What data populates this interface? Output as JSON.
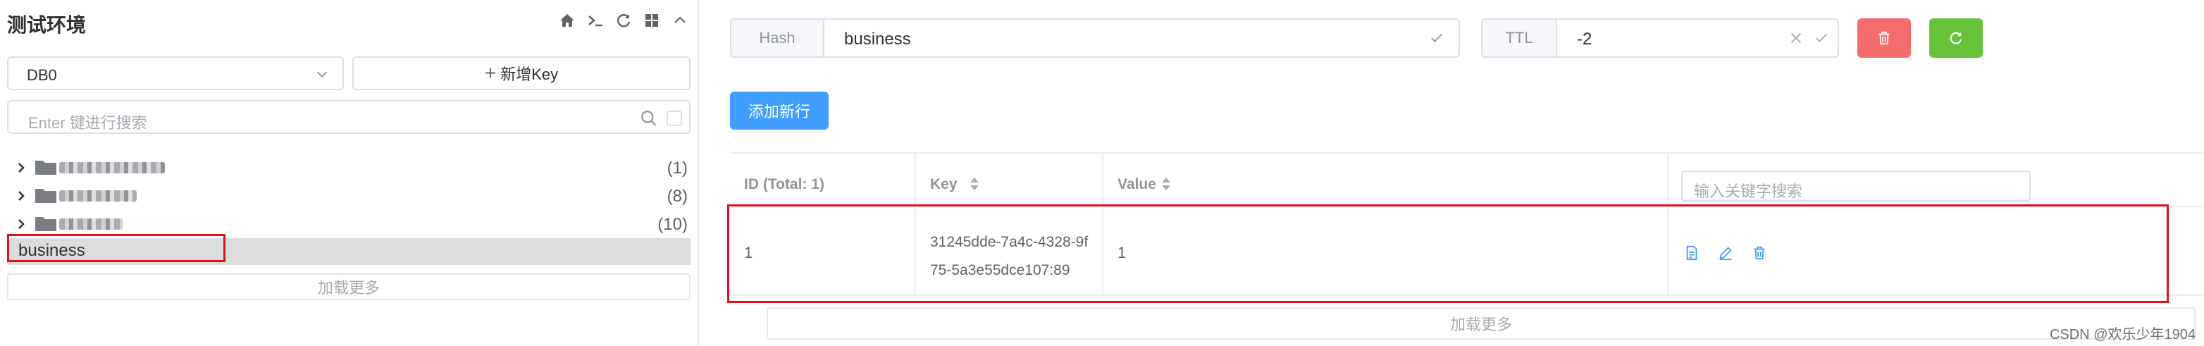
{
  "connection": {
    "title": "测试环境"
  },
  "toolbar_icons": [
    "home-icon",
    "terminal-icon",
    "refresh-icon",
    "grid-icon",
    "chevron-up-icon"
  ],
  "db_select": {
    "value": "DB0"
  },
  "add_key": {
    "label": "新增Key"
  },
  "key_search": {
    "placeholder": "Enter 键进行搜索"
  },
  "tree": {
    "folders": [
      {
        "count": "(1)"
      },
      {
        "count": "(8)"
      },
      {
        "count": "(10)"
      }
    ],
    "selected_key": "business",
    "load_more": "加载更多"
  },
  "key_type": {
    "label": "Hash",
    "value": "business"
  },
  "ttl": {
    "label": "TTL",
    "value": "-2"
  },
  "colors": {
    "primary": "#409eff",
    "danger": "#f56c6c",
    "success": "#67c23a",
    "highlight": "#e0101c"
  },
  "actions": {
    "add_row": "添加新行"
  },
  "table": {
    "headers": {
      "id": "ID (Total: 1)",
      "key": "Key",
      "value": "Value"
    },
    "filter_placeholder": "输入关键字搜索",
    "rows": [
      {
        "id": "1",
        "key_line1": "31245dde-7a4c-4328-9f",
        "key_line2": "75-5a3e55dce107:89",
        "value": "1"
      }
    ],
    "row_action_icons": [
      "document-icon",
      "edit-icon",
      "delete-icon"
    ],
    "load_more": "加载更多"
  },
  "watermark": "CSDN @欢乐少年1904"
}
